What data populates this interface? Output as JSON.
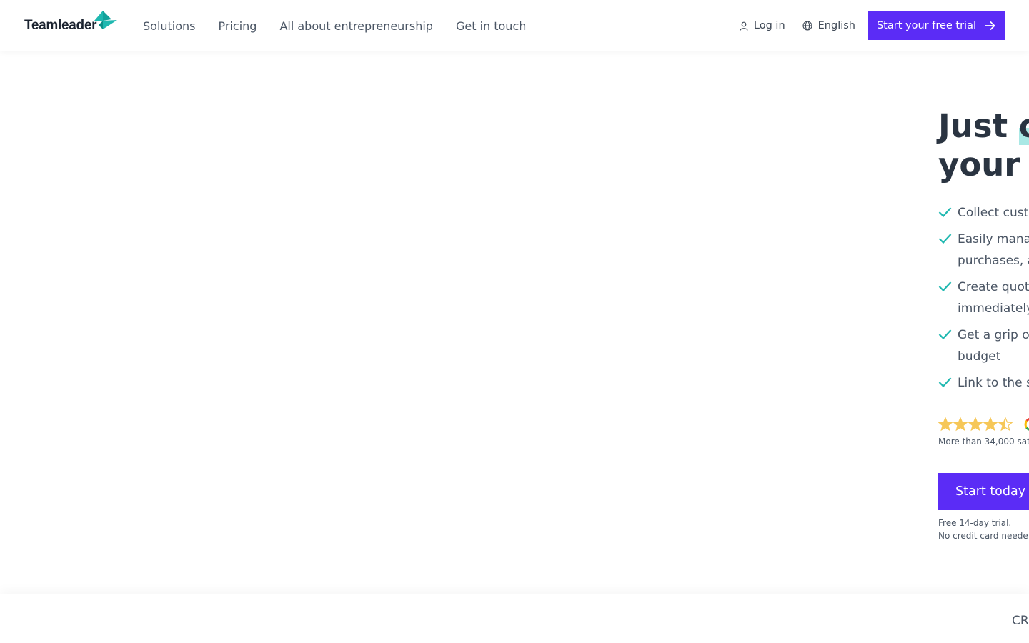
{
  "header": {
    "logo_text": "Teamleader",
    "nav": [
      "Solutions",
      "Pricing",
      "All about entrepreneurship",
      "Get in touch"
    ],
    "login_label": "Log in",
    "language_label": "English",
    "trial_label": "Start your free trial"
  },
  "hero": {
    "headline_line1_a": "Just ",
    "headline_line1_b": "o",
    "headline_line2": "your ",
    "bullets": [
      {
        "lines": [
          "Collect cust"
        ]
      },
      {
        "lines": [
          "Easily mana",
          "purchases, a"
        ]
      },
      {
        "lines": [
          "Create quot",
          "immediately"
        ]
      },
      {
        "lines": [
          "Get a grip o",
          "budget"
        ]
      },
      {
        "lines": [
          "Link to the s"
        ]
      }
    ],
    "rating": 4.5,
    "rating_text": "More than 34,000 sat",
    "cta_label": "Start today",
    "cta_note_1": "Free 14-day trial.",
    "cta_note_2": "No credit card neede"
  },
  "strip": {
    "tab_label": "CR"
  },
  "colors": {
    "brand_purple": "#5b2cf6",
    "teal": "#1fb8b0",
    "star": "#f6c758",
    "text_dark": "#2a3441"
  },
  "icons": [
    "teamleader-logo-icon",
    "user-icon",
    "globe-icon",
    "arrow-right-icon",
    "check-icon",
    "star-icon",
    "google-icon"
  ]
}
